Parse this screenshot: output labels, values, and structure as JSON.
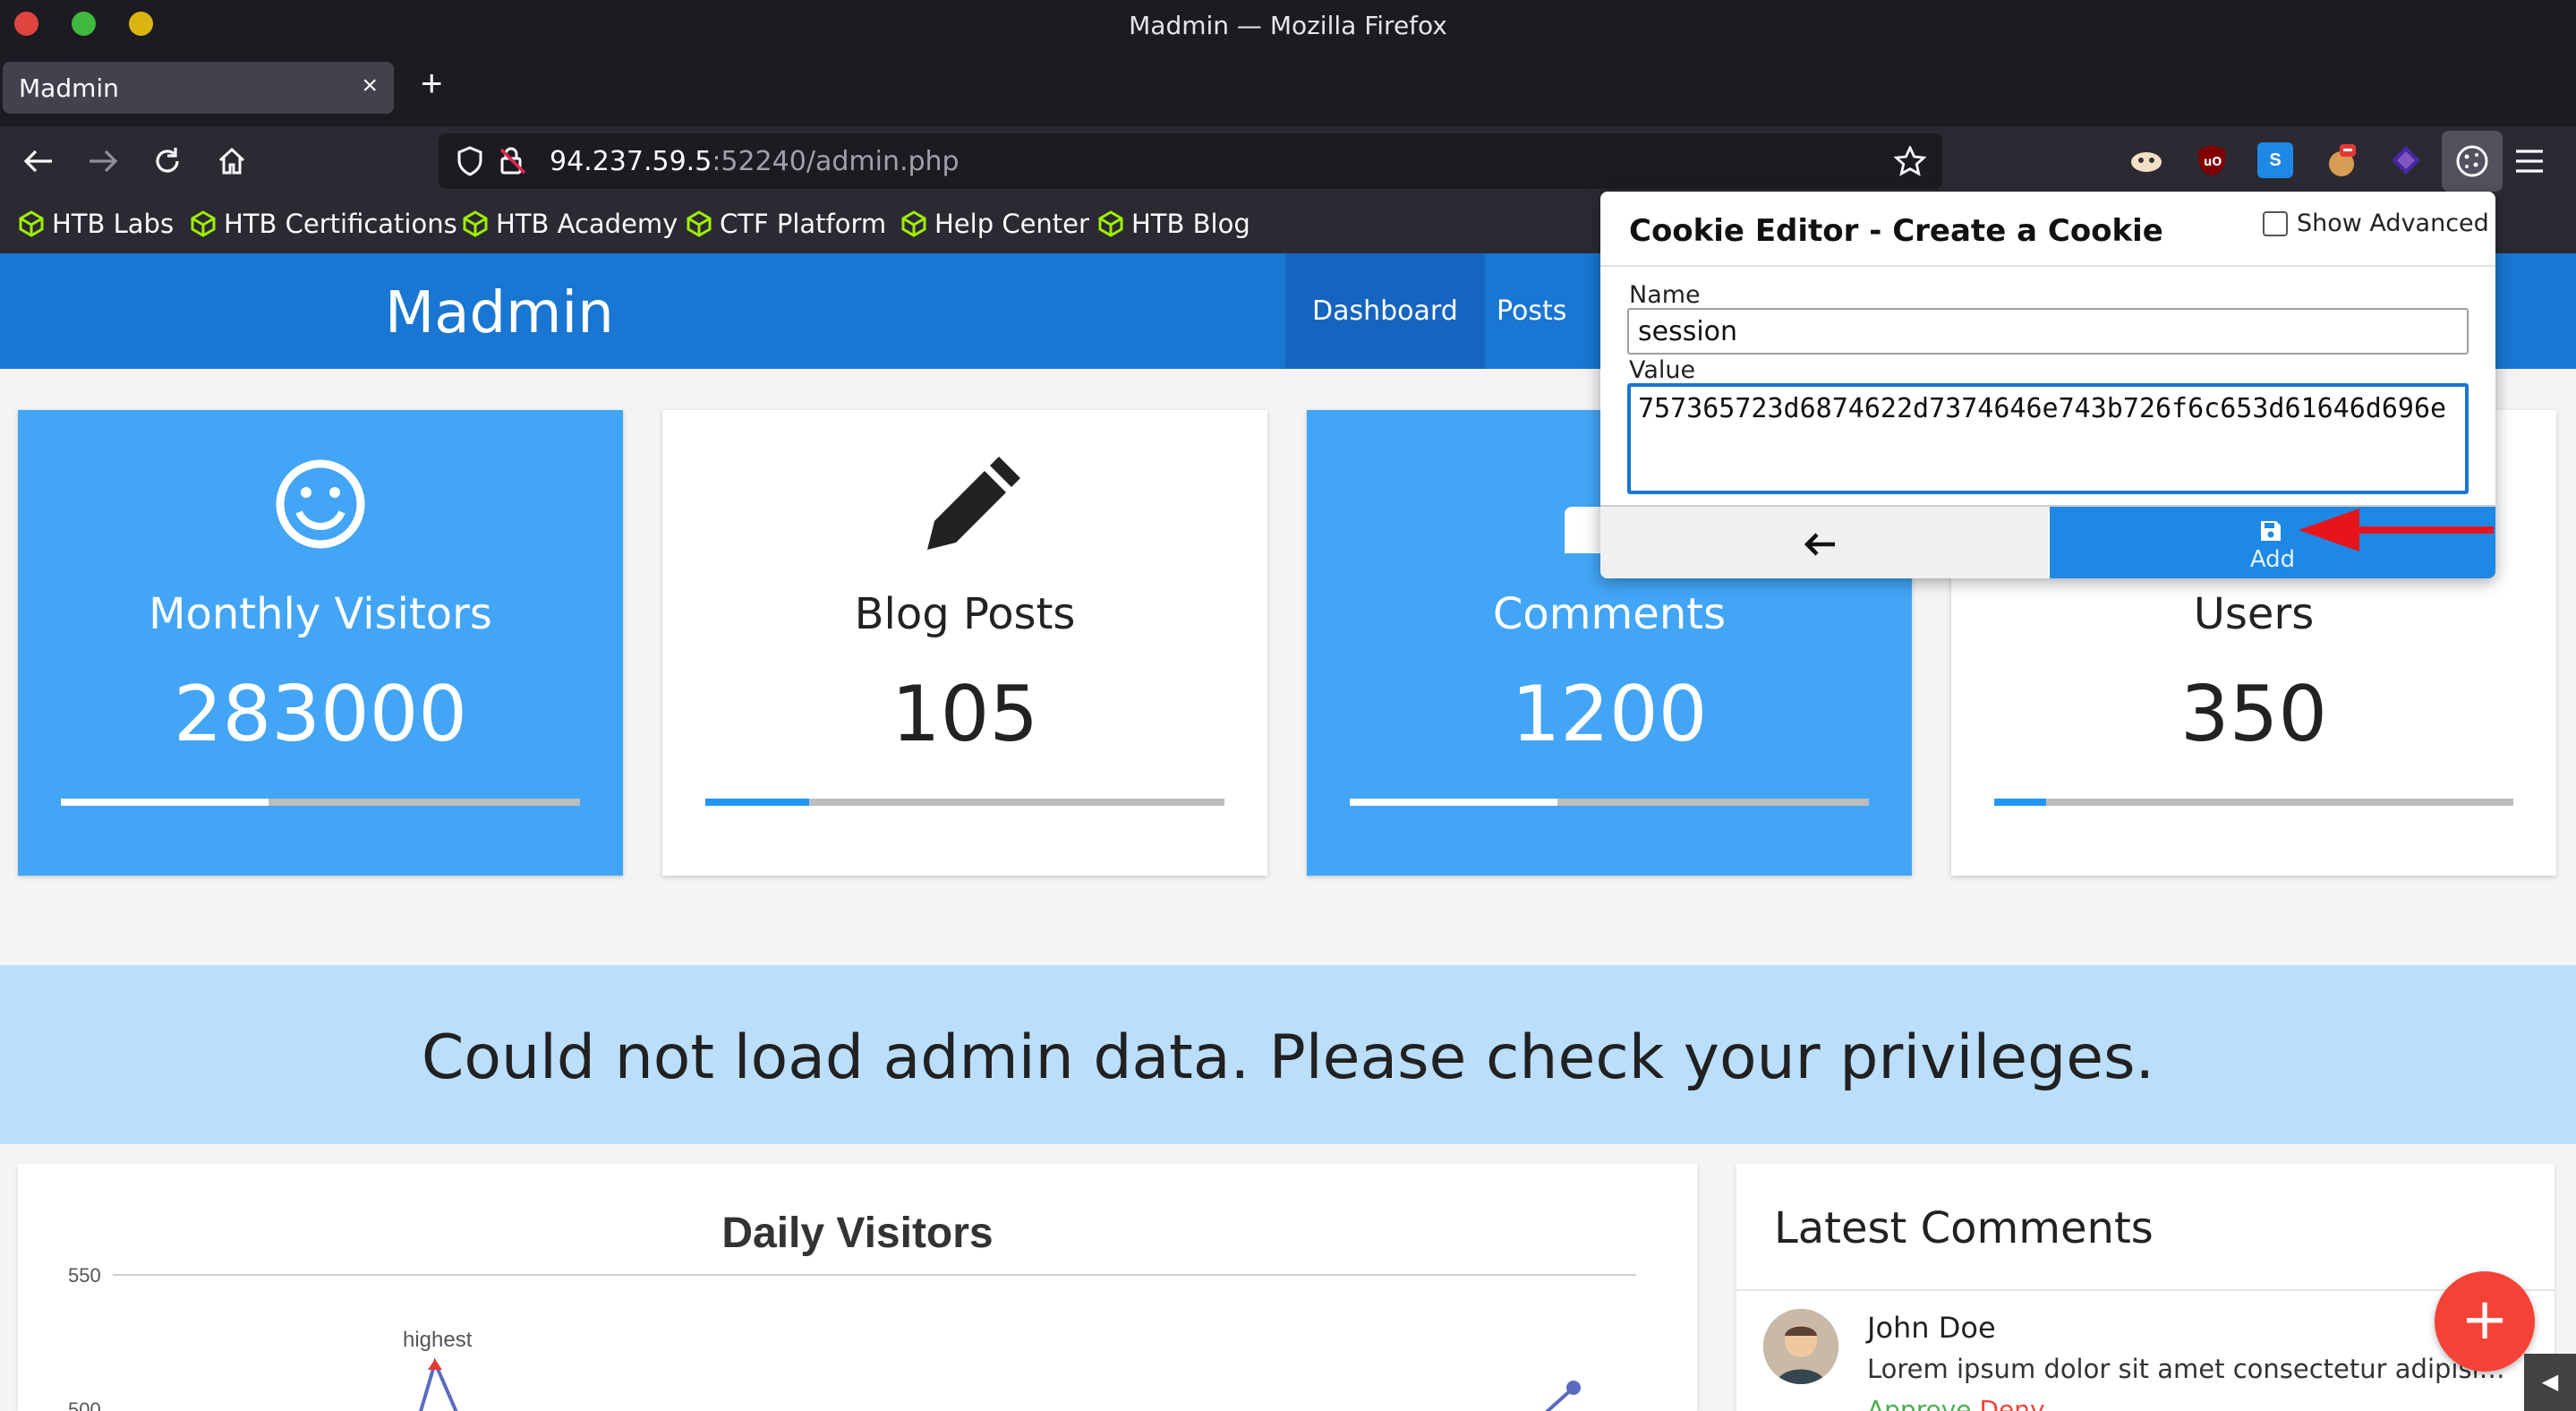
{
  "window": {
    "title": "Madmin — Mozilla Firefox"
  },
  "tab": {
    "title": "Madmin",
    "close": "×",
    "new_tab": "+"
  },
  "url": {
    "host": "94.237.59.5",
    "rest": ":52240/admin.php"
  },
  "bookmarks": [
    {
      "label": "HTB Labs"
    },
    {
      "label": "HTB Certifications"
    },
    {
      "label": "HTB Academy"
    },
    {
      "label": "CTF Platform"
    },
    {
      "label": "Help Center"
    },
    {
      "label": "HTB Blog"
    }
  ],
  "site": {
    "brand": "Madmin",
    "nav": [
      {
        "label": "Dashboard"
      },
      {
        "label": "Posts"
      }
    ]
  },
  "stats": [
    {
      "label": "Monthly Visitors",
      "value": "283000",
      "progress": 0.4,
      "icon": "smiley-icon"
    },
    {
      "label": "Blog Posts",
      "value": "105",
      "progress": 0.2,
      "icon": "pencil-icon"
    },
    {
      "label": "Comments",
      "value": "1200",
      "progress": 0.4,
      "icon": "comment-icon"
    },
    {
      "label": "Users",
      "value": "350",
      "progress": 0.1,
      "icon": "users-icon"
    }
  ],
  "alert": {
    "message": "Could not load admin data. Please check your privileges."
  },
  "chart": {
    "title": "Daily Visitors",
    "tick_top": "550",
    "tick_next": "500",
    "annotation": "highest"
  },
  "chart_data": {
    "type": "line",
    "title": "Daily Visitors",
    "ylim": [
      500,
      550
    ],
    "annotations": [
      "highest"
    ]
  },
  "comments": {
    "title": "Latest Comments",
    "items": [
      {
        "author": "John Doe",
        "text": "Lorem ipsum dolor sit amet consectetur adipisicing elit.",
        "approve": "Approve",
        "deny": "Deny"
      }
    ]
  },
  "fab": {
    "label": "+"
  },
  "cookie_editor": {
    "title": "Cookie Editor - Create a Cookie",
    "show_advanced": "Show Advanced",
    "name_label": "Name",
    "name_value": "session",
    "value_label": "Value",
    "value_value": "757365723d6874622d7374646e743b726f6c653d61646d696e",
    "back_icon": "arrow-left-icon",
    "add_label": "Add"
  },
  "colors": {
    "header_blue": "#1976d2",
    "card_blue": "#42a5f5",
    "alert_bg": "#bbdefb",
    "fab_red": "#f44336",
    "annotation_arrow": "#e8141b"
  }
}
